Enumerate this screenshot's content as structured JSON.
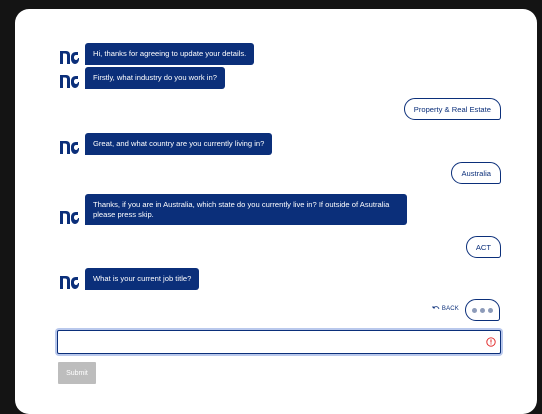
{
  "colors": {
    "accent": "#0b2f7a",
    "error": "#e02020",
    "submit_disabled": "#bdbdbd"
  },
  "chat": {
    "bot_icon": "brand-logo-icon",
    "messages": [
      {
        "from": "bot",
        "text": "Hi, thanks for agreeing to update your details."
      },
      {
        "from": "bot",
        "text": "Firstly, what industry do you work in?"
      },
      {
        "from": "user",
        "text": "Property & Real Estate"
      },
      {
        "from": "bot",
        "text": "Great, and what country are you currently living in?"
      },
      {
        "from": "user",
        "text": "Australia"
      },
      {
        "from": "bot",
        "text": "Thanks, if you are in Australia, which state do you currently live in? If outside of Asutralia please press skip."
      },
      {
        "from": "user",
        "text": "ACT"
      },
      {
        "from": "bot",
        "text": "What is your current job title?"
      }
    ]
  },
  "back_label": "BACK",
  "typing_icon": "ellipsis-icon",
  "input": {
    "value": "",
    "placeholder": "",
    "error_icon": "error-circle-icon"
  },
  "submit_label": "Submit"
}
